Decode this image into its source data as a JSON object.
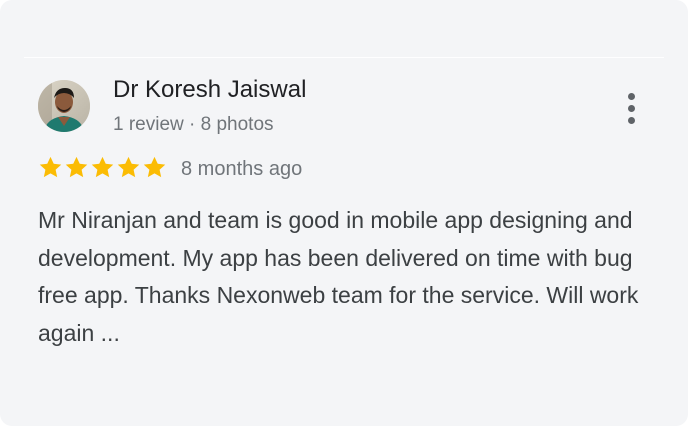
{
  "review": {
    "reviewer_name": "Dr Koresh Jaiswal",
    "reviewer_meta": "1 review · 8 photos",
    "rating": 5,
    "rating_max": 5,
    "time": "8 months ago",
    "text": "Mr Niranjan and team is good in mobile app designing and development. My app has been delivered on time with bug free app. Thanks Nexonweb team for the service. Will work again ..."
  },
  "icons": {
    "star": "star-icon",
    "more": "more-vert-icon"
  },
  "colors": {
    "star": "#fbbc04",
    "card_bg": "#f4f5f7",
    "secondary_text": "#70757a",
    "body_text": "#3c4043"
  }
}
